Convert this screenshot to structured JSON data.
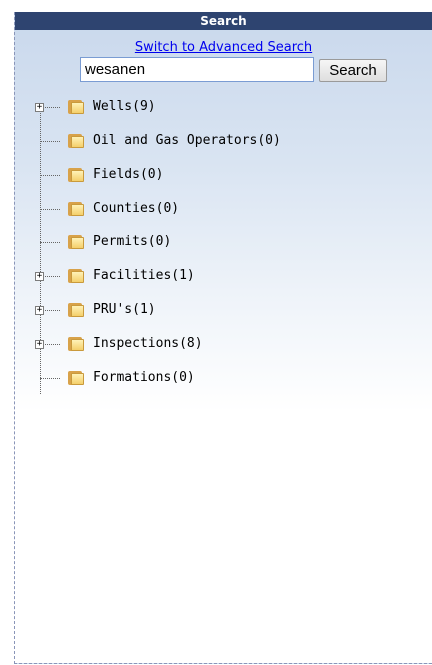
{
  "panel": {
    "title": "Search",
    "advanced_link": "Switch to Advanced Search"
  },
  "search": {
    "value": "wesanen",
    "button_label": "Search"
  },
  "tree": {
    "items": [
      {
        "label": "Wells(9)",
        "expandable": true,
        "icon": "folder-icon"
      },
      {
        "label": "Oil and Gas Operators(0)",
        "expandable": false,
        "icon": "folder-icon"
      },
      {
        "label": "Fields(0)",
        "expandable": false,
        "icon": "folder-icon"
      },
      {
        "label": "Counties(0)",
        "expandable": false,
        "icon": "folder-icon"
      },
      {
        "label": "Permits(0)",
        "expandable": false,
        "icon": "folder-icon"
      },
      {
        "label": "Facilities(1)",
        "expandable": true,
        "icon": "folder-icon"
      },
      {
        "label": "PRU's(1)",
        "expandable": true,
        "icon": "folder-icon"
      },
      {
        "label": "Inspections(8)",
        "expandable": true,
        "icon": "folder-icon"
      },
      {
        "label": "Formations(0)",
        "expandable": false,
        "icon": "folder-icon"
      }
    ],
    "expander_glyph": "+"
  },
  "colors": {
    "title_bar": "#2e4470",
    "link": "#0000ee",
    "panel_gradient_top": "#c9d8ec"
  }
}
